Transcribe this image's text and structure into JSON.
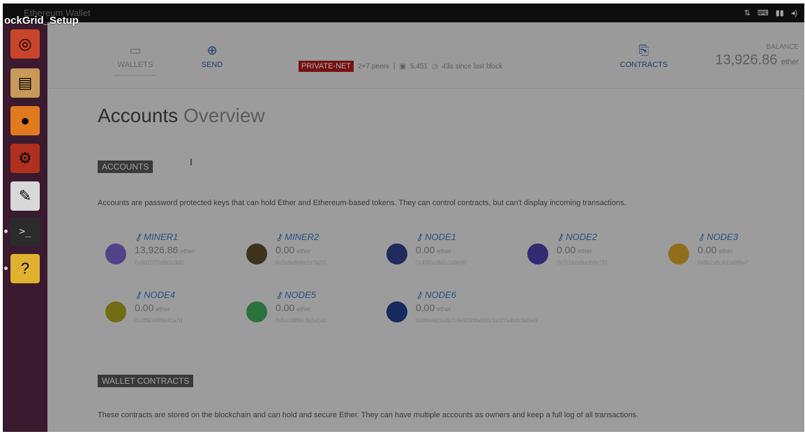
{
  "window": {
    "title": "Ethereum Wallet",
    "overlay_label": "ockGrid_Setup"
  },
  "tray": [
    "⇅",
    "⌨",
    "▮▮",
    "◂)"
  ],
  "launcher": [
    {
      "name": "ubuntu-dash-icon",
      "glyph": "◎",
      "bg": "#c8442a"
    },
    {
      "name": "files-icon",
      "glyph": "▤",
      "bg": "#c89a5a"
    },
    {
      "name": "firefox-icon",
      "glyph": "●",
      "bg": "#e07a1f"
    },
    {
      "name": "system-settings-icon",
      "glyph": "⚙",
      "bg": "#b03020"
    },
    {
      "name": "text-editor-icon",
      "glyph": "✎",
      "bg": "#d8d8d8"
    },
    {
      "name": "terminal-icon",
      "glyph": ">_",
      "bg": "#2b2b2b"
    },
    {
      "name": "help-icon",
      "glyph": "?",
      "bg": "#e0b030"
    }
  ],
  "nav": {
    "wallets": "WALLETS",
    "send": "SEND",
    "contracts": "CONTRACTS",
    "private_net": "PRIVATE-NET",
    "peers": "2+7 peers",
    "block": "5,451",
    "since_block": "43s since last block"
  },
  "balance": {
    "label": "BALANCE",
    "value": "13,926.86",
    "unit": "ether"
  },
  "heading": {
    "bold": "Accounts",
    "light": "Overview"
  },
  "accounts_section": {
    "label": "ACCOUNTS",
    "description": "Accounts are password protected keys that can hold Ether and Ethereum-based tokens. They can control contracts, but can't display incoming transactions."
  },
  "accounts": [
    {
      "name": "MINER1",
      "amount": "13,926.86",
      "unit": "ether",
      "address": "0x8d1f7f7e6b1c3d0",
      "color": "#7a63c9"
    },
    {
      "name": "MINER2",
      "amount": "0.00",
      "unit": "ether",
      "address": "0x3a9e8b8e1e7a2f1",
      "color": "#5a4a2a"
    },
    {
      "name": "NODE1",
      "amount": "0.00",
      "unit": "ether",
      "address": "0x4f85a3b2c1d8e90",
      "color": "#2f3f8a"
    },
    {
      "name": "NODE2",
      "amount": "0.00",
      "unit": "ether",
      "address": "0x7c1e2d9a0b8e7f3",
      "color": "#4b3fa8"
    },
    {
      "name": "NODE3",
      "amount": "0.00",
      "unit": "ether",
      "address": "0x9b2a6c4d1e0f8a7",
      "color": "#d6a22a"
    },
    {
      "name": "NODE4",
      "amount": "0.00",
      "unit": "ether",
      "address": "0x2ff9048f9b41a7d",
      "color": "#a8a020"
    },
    {
      "name": "NODE5",
      "amount": "0.00",
      "unit": "ether",
      "address": "0x5a7d8f9c3b2e1a0",
      "color": "#3fa85a"
    },
    {
      "name": "NODE6",
      "amount": "0.00",
      "unit": "ether",
      "address": "0x8f4e9d1a2b7c6e5f3d8a9b0c1e2f7a4b6c5d3e8",
      "color": "#1f3f8a"
    }
  ],
  "wallet_contracts_section": {
    "label": "WALLET CONTRACTS",
    "description": "These contracts are stored on the blockchain and can hold and secure Ether. They can have multiple accounts as owners and keep a full log of all transactions."
  }
}
